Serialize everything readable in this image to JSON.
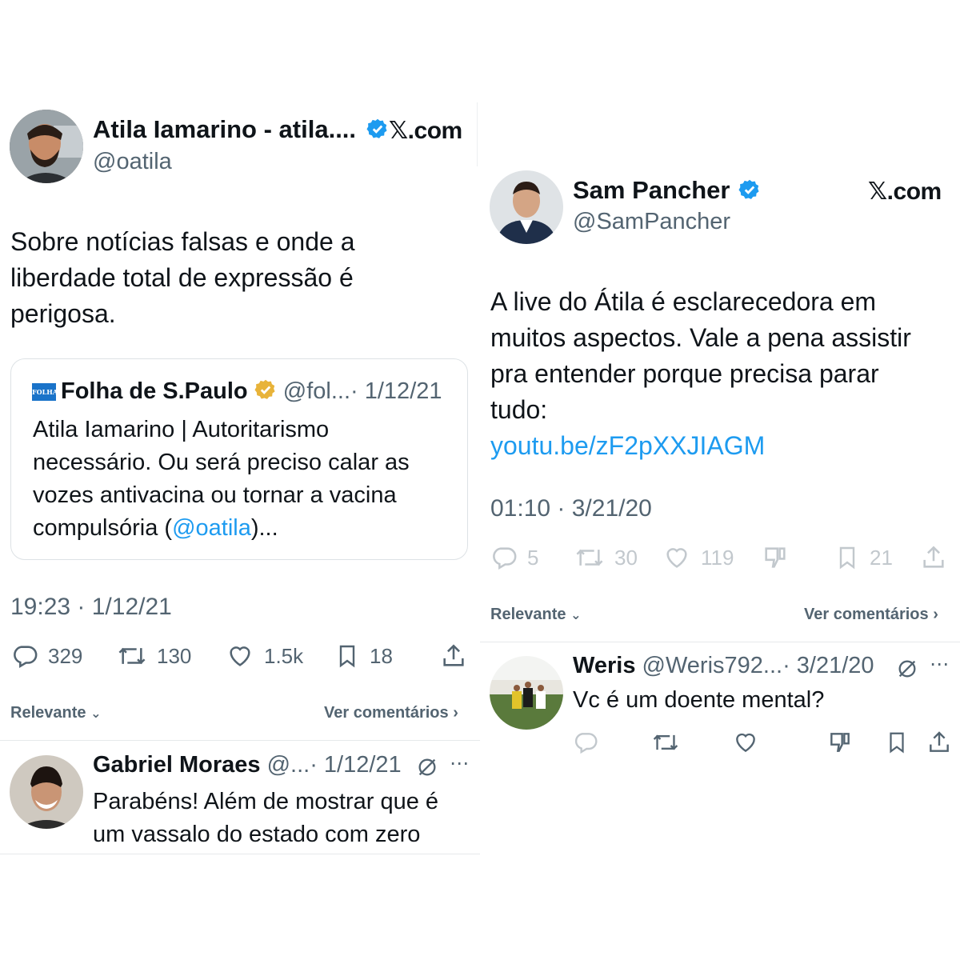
{
  "left": {
    "author": {
      "name": "Atila Iamarino - atila....",
      "handle": "@oatila",
      "site": "𝕏.com"
    },
    "text": [
      "Sobre notícias falsas e onde a",
      "liberdade total de expressão é",
      "perigosa."
    ],
    "quote": {
      "logo_text": "FOLHA",
      "name": "Folha de S.Paulo",
      "handle": "@fol...",
      "date": "· 1/12/21",
      "lines": [
        "Atila Iamarino | Autoritarismo",
        "necessário. Ou será preciso calar as",
        "vozes antivacina ou tornar a vacina"
      ],
      "last_line_prefix": "compulsória (",
      "last_line_mention": "@oatila",
      "last_line_suffix": ")..."
    },
    "timestamp": "19:23 · 1/12/21",
    "stats": {
      "replies": "329",
      "retweets": "130",
      "likes": "1.5k",
      "bookmarks": "18"
    },
    "sort_label": "Relevante",
    "see_comments": "Ver comentários",
    "reply": {
      "name": "Gabriel Moraes",
      "handle": "@...",
      "date": "· 1/12/21",
      "lines": [
        "Parabéns! Além de mostrar que é",
        "um vassalo do estado com zero"
      ]
    }
  },
  "right": {
    "author": {
      "name": "Sam Pancher",
      "handle": "@SamPancher",
      "site": "𝕏.com"
    },
    "text": [
      "A live do Átila é esclarecedora em",
      "muitos aspectos. Vale a pena assistir",
      "pra entender porque precisa parar",
      "tudo:"
    ],
    "link": "youtu.be/zF2pXXJIAGM",
    "timestamp": "01:10 · 3/21/20",
    "stats": {
      "replies": "5",
      "retweets": "30",
      "likes": "119",
      "bookmarks": "21"
    },
    "sort_label": "Relevante",
    "see_comments": "Ver comentários",
    "reply": {
      "name": "Weris",
      "handle": "@Weris792...",
      "date": "· 3/21/20",
      "text": "Vc é um doente mental?"
    }
  },
  "colors": {
    "verified_blue": "#1d9bf0",
    "verified_gold": "#e8b339",
    "text_gray": "#536471",
    "link_blue": "#1d9bf0"
  }
}
